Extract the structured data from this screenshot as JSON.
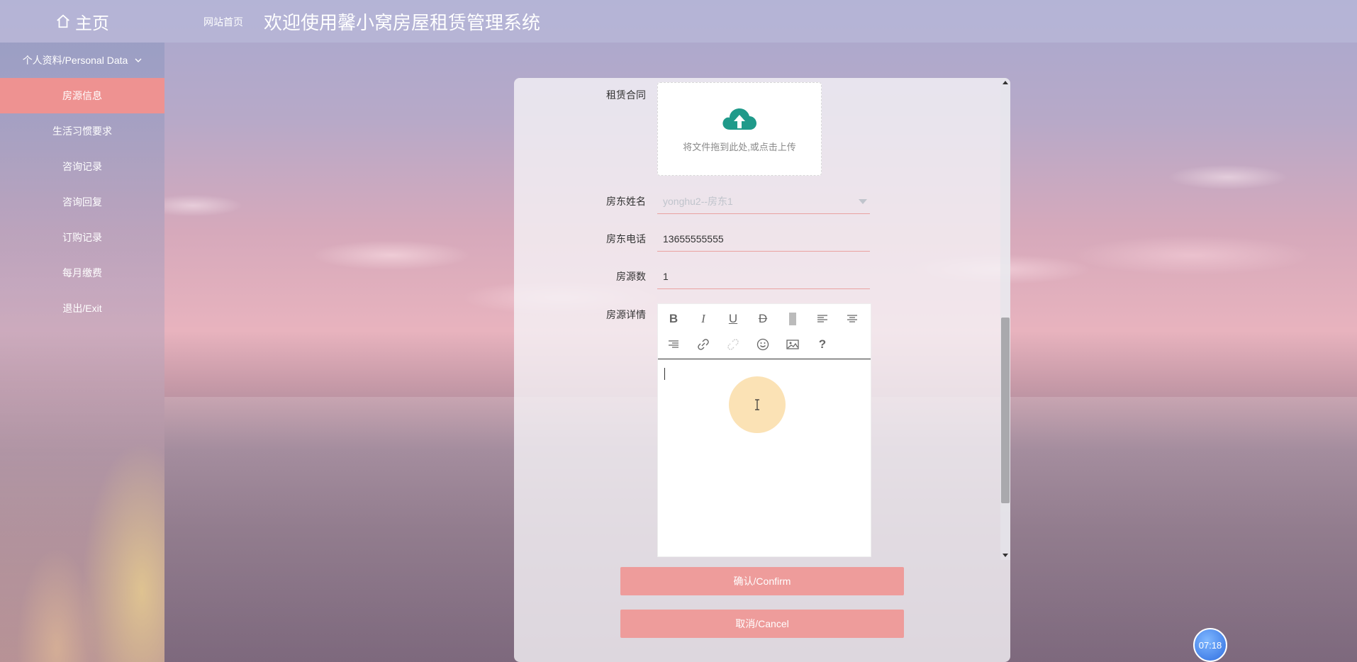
{
  "header": {
    "home_label": "主页",
    "site_link": "网站首页",
    "title": "欢迎使用馨小窝房屋租赁管理系统"
  },
  "sidebar": {
    "group_label": "个人资料/Personal Data",
    "items": [
      {
        "label": "房源信息",
        "active": true
      },
      {
        "label": "生活习惯要求",
        "active": false
      },
      {
        "label": "咨询记录",
        "active": false
      },
      {
        "label": "咨询回复",
        "active": false
      },
      {
        "label": "订购记录",
        "active": false
      },
      {
        "label": "每月缴费",
        "active": false
      },
      {
        "label": "退出/Exit",
        "active": false
      }
    ]
  },
  "form": {
    "contract": {
      "label": "租赁合同",
      "upload_text": "将文件拖到此处,或点击上传"
    },
    "landlord_name": {
      "label": "房东姓名",
      "value": "yonghu2--房东1"
    },
    "landlord_phone": {
      "label": "房东电话",
      "value": "13655555555"
    },
    "house_count": {
      "label": "房源数",
      "value": "1"
    },
    "details": {
      "label": "房源详情"
    }
  },
  "editor_toolbar": [
    "bold-icon",
    "italic-icon",
    "underline-icon",
    "strikethrough-icon",
    "background-color-icon",
    "align-left-icon",
    "align-center-icon",
    "align-right-icon",
    "link-icon",
    "unlink-icon",
    "emoji-icon",
    "image-icon",
    "help-icon"
  ],
  "buttons": {
    "confirm": "确认/Confirm",
    "cancel": "取消/Cancel"
  },
  "clock": "07:18",
  "colors": {
    "accent": "#ee9291",
    "button": "#ee9c9b",
    "upload_icon": "#1f9a8a"
  }
}
